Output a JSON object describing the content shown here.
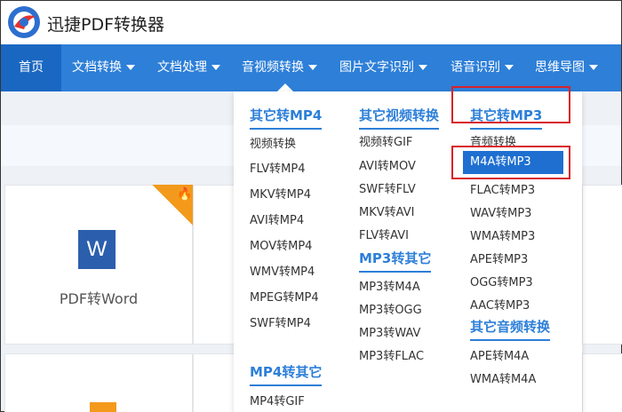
{
  "app": {
    "brand": "迅捷PDF转换器"
  },
  "nav": {
    "items": [
      {
        "label": "首页",
        "has_caret": false
      },
      {
        "label": "文档转换",
        "has_caret": true
      },
      {
        "label": "文档处理",
        "has_caret": true
      },
      {
        "label": "音视频转换",
        "has_caret": true
      },
      {
        "label": "图片文字识别",
        "has_caret": true
      },
      {
        "label": "语音识别",
        "has_caret": true
      },
      {
        "label": "思维导图",
        "has_caret": true
      }
    ]
  },
  "cards": {
    "word_icon": "W",
    "pdf_to_word": "PDF转Word"
  },
  "dropdown": {
    "col1": {
      "heading1": "其它转MP4",
      "items1": [
        "视频转换",
        "FLV转MP4",
        "MKV转MP4",
        "AVI转MP4",
        "MOV转MP4",
        "WMV转MP4",
        "MPEG转MP4",
        "SWF转MP4"
      ],
      "heading2": "MP4转其它",
      "items2": [
        "MP4转GIF"
      ]
    },
    "col2": {
      "heading1": "其它视频转换",
      "items1": [
        "视频转GIF",
        "AVI转MOV",
        "SWF转FLV",
        "MKV转AVI",
        "FLV转AVI"
      ],
      "heading2": "MP3转其它",
      "items2": [
        "MP3转M4A",
        "MP3转OGG",
        "MP3转WAV",
        "MP3转FLAC"
      ]
    },
    "col3": {
      "heading1": "其它转MP3",
      "items1": [
        "音频转换",
        "M4A转MP3",
        "FLAC转MP3",
        "WAV转MP3",
        "WMA转MP3",
        "APE转MP3",
        "OGG转MP3",
        "AAC转MP3"
      ],
      "heading2": "其它音频转换",
      "items2": [
        "APE转M4A",
        "WMA转M4A"
      ]
    }
  },
  "colors": {
    "nav": "#2d7fd8",
    "nav_active": "#1a67c2",
    "accent": "#2d7fd8",
    "highlight": "#d8222a"
  }
}
